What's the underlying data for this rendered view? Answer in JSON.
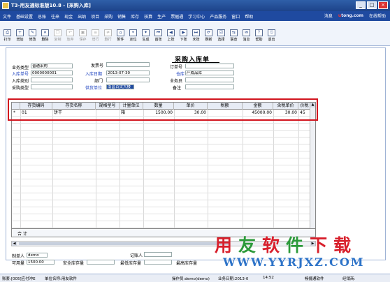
{
  "window": {
    "title": "T3-用友通标准版10.8 - [采购入库]",
    "min": "_",
    "max": "□",
    "close": "×"
  },
  "menu": {
    "items": [
      "文件",
      "基础设置",
      "总账",
      "往来",
      "现金",
      "出纳",
      "项目",
      "采购",
      "销售",
      "库存",
      "核算",
      "生产",
      "票据通",
      "学习中心",
      "产品服务",
      "窗口",
      "帮助"
    ],
    "right_links": [
      "消息",
      "在线帮助"
    ],
    "logo_prefix": "u",
    "logo_main": "tong.com"
  },
  "toolbar": {
    "buttons": [
      {
        "label": "打印",
        "icon": "printer-icon",
        "glyph": "⎙",
        "enabled": true
      },
      {
        "label": "增加",
        "icon": "add-icon",
        "glyph": "+",
        "enabled": true
      },
      {
        "label": "修改",
        "icon": "edit-icon",
        "glyph": "✎",
        "enabled": true
      },
      {
        "label": "删除",
        "icon": "delete-icon",
        "glyph": "✕",
        "enabled": true
      },
      {
        "label": "复制",
        "icon": "copy-icon",
        "glyph": "❐",
        "enabled": false
      },
      {
        "label": "放弃",
        "icon": "abandon-icon",
        "glyph": "↶",
        "enabled": false
      },
      {
        "label": "保存",
        "icon": "save-icon",
        "glyph": "▣",
        "enabled": false
      },
      {
        "label": "增行",
        "icon": "add-row-icon",
        "glyph": "≡",
        "enabled": false
      },
      {
        "label": "删行",
        "icon": "delete-row-icon",
        "glyph": "≠",
        "enabled": false
      },
      {
        "label": "附件",
        "icon": "attach-icon",
        "glyph": "⌂",
        "enabled": true
      },
      {
        "label": "定位",
        "icon": "locate-icon",
        "glyph": "⌖",
        "enabled": true
      },
      {
        "label": "生成",
        "icon": "generate-icon",
        "glyph": "✦",
        "enabled": true
      },
      {
        "label": "首张",
        "icon": "first-icon",
        "glyph": "⏮",
        "enabled": true
      },
      {
        "label": "上张",
        "icon": "prev-icon",
        "glyph": "◀",
        "enabled": true
      },
      {
        "label": "下张",
        "icon": "next-icon",
        "glyph": "▶",
        "enabled": true
      },
      {
        "label": "末张",
        "icon": "last-icon",
        "glyph": "⏭",
        "enabled": true
      },
      {
        "label": "刷新",
        "icon": "refresh-icon",
        "glyph": "⟳",
        "enabled": true
      },
      {
        "label": "选择",
        "icon": "select-icon",
        "glyph": "☑",
        "enabled": true
      },
      {
        "label": "联查",
        "icon": "linked-query-icon",
        "glyph": "⇆",
        "enabled": true
      },
      {
        "label": "消息",
        "icon": "message-icon",
        "glyph": "✉",
        "enabled": true
      },
      {
        "label": "帮助",
        "icon": "help-icon",
        "glyph": "?",
        "enabled": true
      },
      {
        "label": "退出",
        "icon": "exit-icon",
        "glyph": "⎋",
        "enabled": true
      }
    ]
  },
  "doc": {
    "title": "采购入库单",
    "fields": {
      "business_type": {
        "label": "业务类型",
        "value": "普通采购"
      },
      "invoice_no": {
        "label": "发票号",
        "value": ""
      },
      "order_no": {
        "label": "订单号",
        "value": ""
      },
      "receipt_no": {
        "label": "入库单号",
        "value": "0000000001"
      },
      "receipt_date": {
        "label": "入库日期",
        "value": "2013-07-30"
      },
      "warehouse": {
        "label": "仓库",
        "value": "产成品库"
      },
      "receipt_category": {
        "label": "入库类别",
        "value": ""
      },
      "department": {
        "label": "部门",
        "value": ""
      },
      "salesperson": {
        "label": "业务员",
        "value": ""
      },
      "purchase_type": {
        "label": "采购类型",
        "value": ""
      },
      "supplier": {
        "label": "供货单位",
        "value": "南昌百货大楼"
      },
      "remark": {
        "label": "备注",
        "value": ""
      }
    }
  },
  "grid": {
    "columns": [
      "存货编码",
      "存货名称",
      "规格型号",
      "计量单位",
      "数量",
      "单价",
      "税额",
      "金额",
      "含税单价",
      "价税合计"
    ],
    "col_header_short": [
      "存货编码",
      "存货名称",
      "规格型号",
      "计量单位",
      "数量",
      "单价",
      "税额",
      "金额",
      "含税单价",
      "价税"
    ],
    "rows": [
      {
        "marker": "*",
        "code": "01",
        "name": "饼干",
        "spec": "",
        "unit": "箱",
        "qty": "1500.00",
        "price": "30.00",
        "tax": "",
        "amount": "45000.00",
        "tax_price": "30.00",
        "total": "45"
      }
    ],
    "total_label": "合 计",
    "scroll_up": "▲",
    "scroll_left": "◀",
    "scroll_right": "▶"
  },
  "footer": {
    "creator_label": "制单人",
    "creator_value": "demo",
    "bookkeeper_label": "记账人",
    "available_label": "可用量",
    "available_value": "1500.00",
    "safety_label": "安全库存量",
    "min_label": "最低库存量",
    "max_label": "最高库存量"
  },
  "watermark": {
    "line1_a": "用",
    "line1_b": "友",
    "line1_c": "软",
    "line1_d": "件",
    "line1_e": "下",
    "line1_f": "载",
    "line2": "WWW.YYRJXZ.COM"
  },
  "status": {
    "account": "账套:[005]应付冲E",
    "company": "单位名称:用友软件",
    "operator": "操作员:demo(demo)",
    "biz_date": "业务日期:2013-0",
    "time": "14:52",
    "vendor": "畅捷通软件",
    "hotline": "经销商:"
  },
  "colors": {
    "menu_bg": "#1f4aa0",
    "highlight_red": "#d2141e",
    "watermark_red": "#d8202c",
    "watermark_green": "#2c9a3a",
    "watermark_blue": "#2d73c8",
    "label_blue": "#1a3fbf"
  }
}
